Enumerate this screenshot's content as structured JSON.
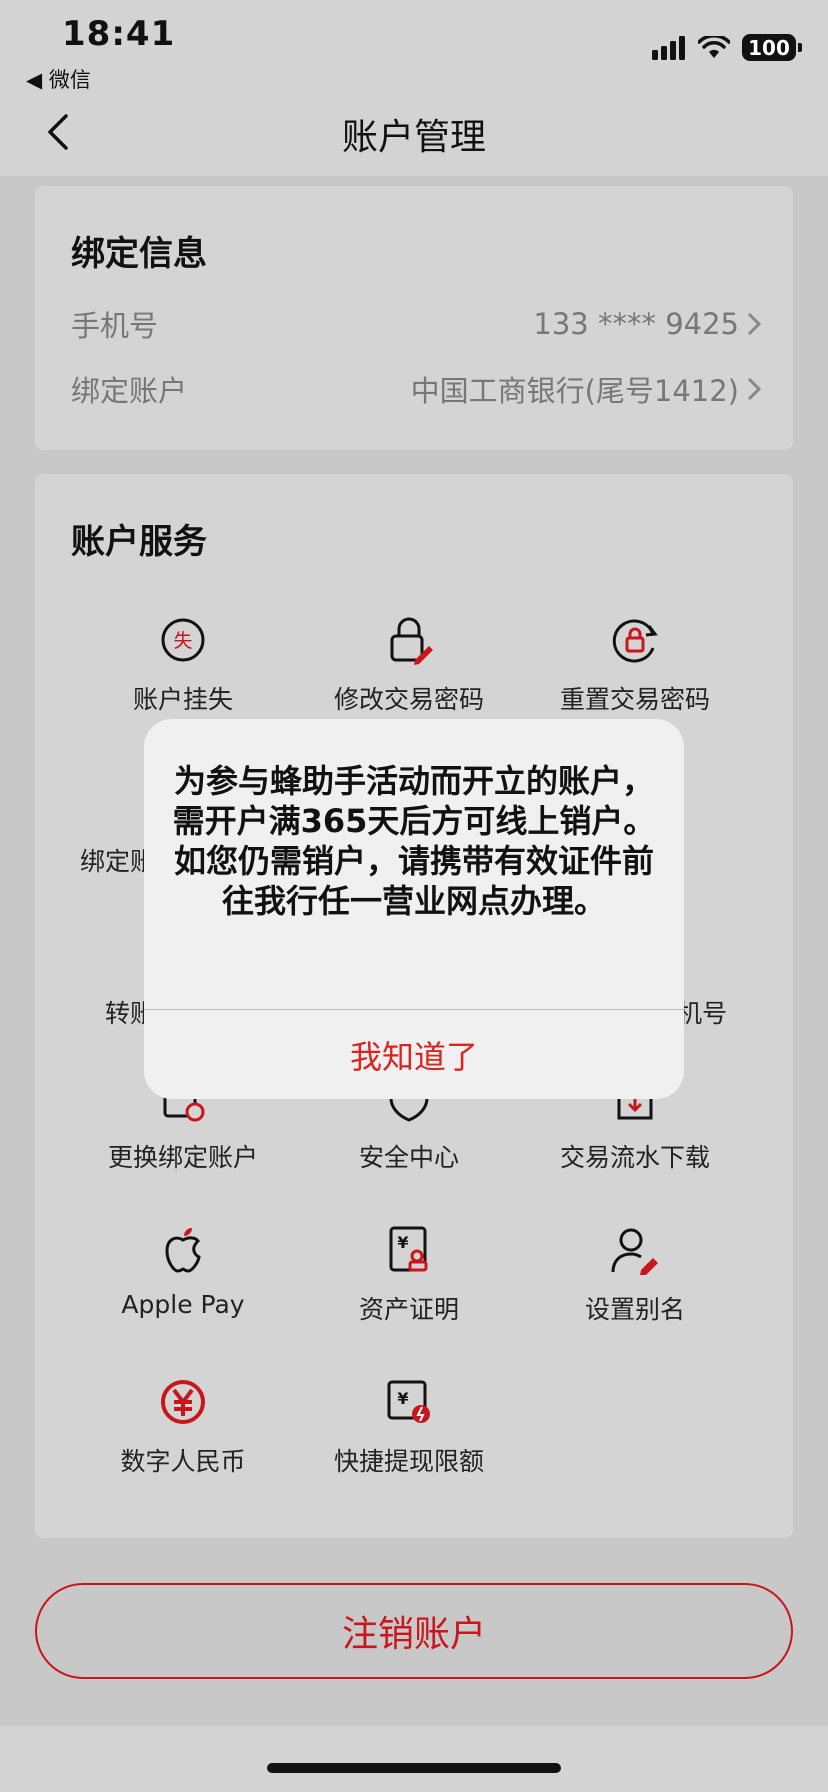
{
  "status": {
    "time": "18:41",
    "back_app": "◀ 微信",
    "battery": "100"
  },
  "nav": {
    "title": "账户管理"
  },
  "binding": {
    "title": "绑定信息",
    "rows": [
      {
        "label": "手机号",
        "value": "133 **** 9425"
      },
      {
        "label": "绑定账户",
        "value": "中国工商银行(尾号1412)"
      }
    ]
  },
  "services": {
    "title": "账户服务",
    "items": [
      {
        "label": "账户挂失",
        "icon": "lost-report-icon"
      },
      {
        "label": "修改交易密码",
        "icon": "lock-edit-icon"
      },
      {
        "label": "重置交易密码",
        "icon": "lock-reset-icon"
      },
      {
        "label": "更换绑定账户",
        "icon": "card-switch-icon"
      },
      {
        "label": "安全中心",
        "icon": "shield-icon"
      },
      {
        "label": "交易流水下载",
        "icon": "document-download-icon"
      },
      {
        "label": "Apple Pay",
        "icon": "apple-icon"
      },
      {
        "label": "资产证明",
        "icon": "asset-certificate-icon"
      },
      {
        "label": "设置别名",
        "icon": "user-edit-icon"
      },
      {
        "label": "数字人民币",
        "icon": "digital-rmb-icon"
      },
      {
        "label": "快捷提现限额",
        "icon": "withdraw-limit-icon"
      }
    ],
    "partial_labels": {
      "row2_left": "绑定账",
      "row2_right": "」",
      "row3_left": "转账",
      "row3_right": "机号"
    }
  },
  "cancel_button": "注销账户",
  "dialog": {
    "message": "为参与蜂助手活动而开立的账户，需开户满365天后方可线上销户。如您仍需销户，请携带有效证件前往我行任一营业网点办理。",
    "button": "我知道了"
  },
  "colors": {
    "accent": "#c8161d",
    "dialog_button": "#d7261f"
  }
}
